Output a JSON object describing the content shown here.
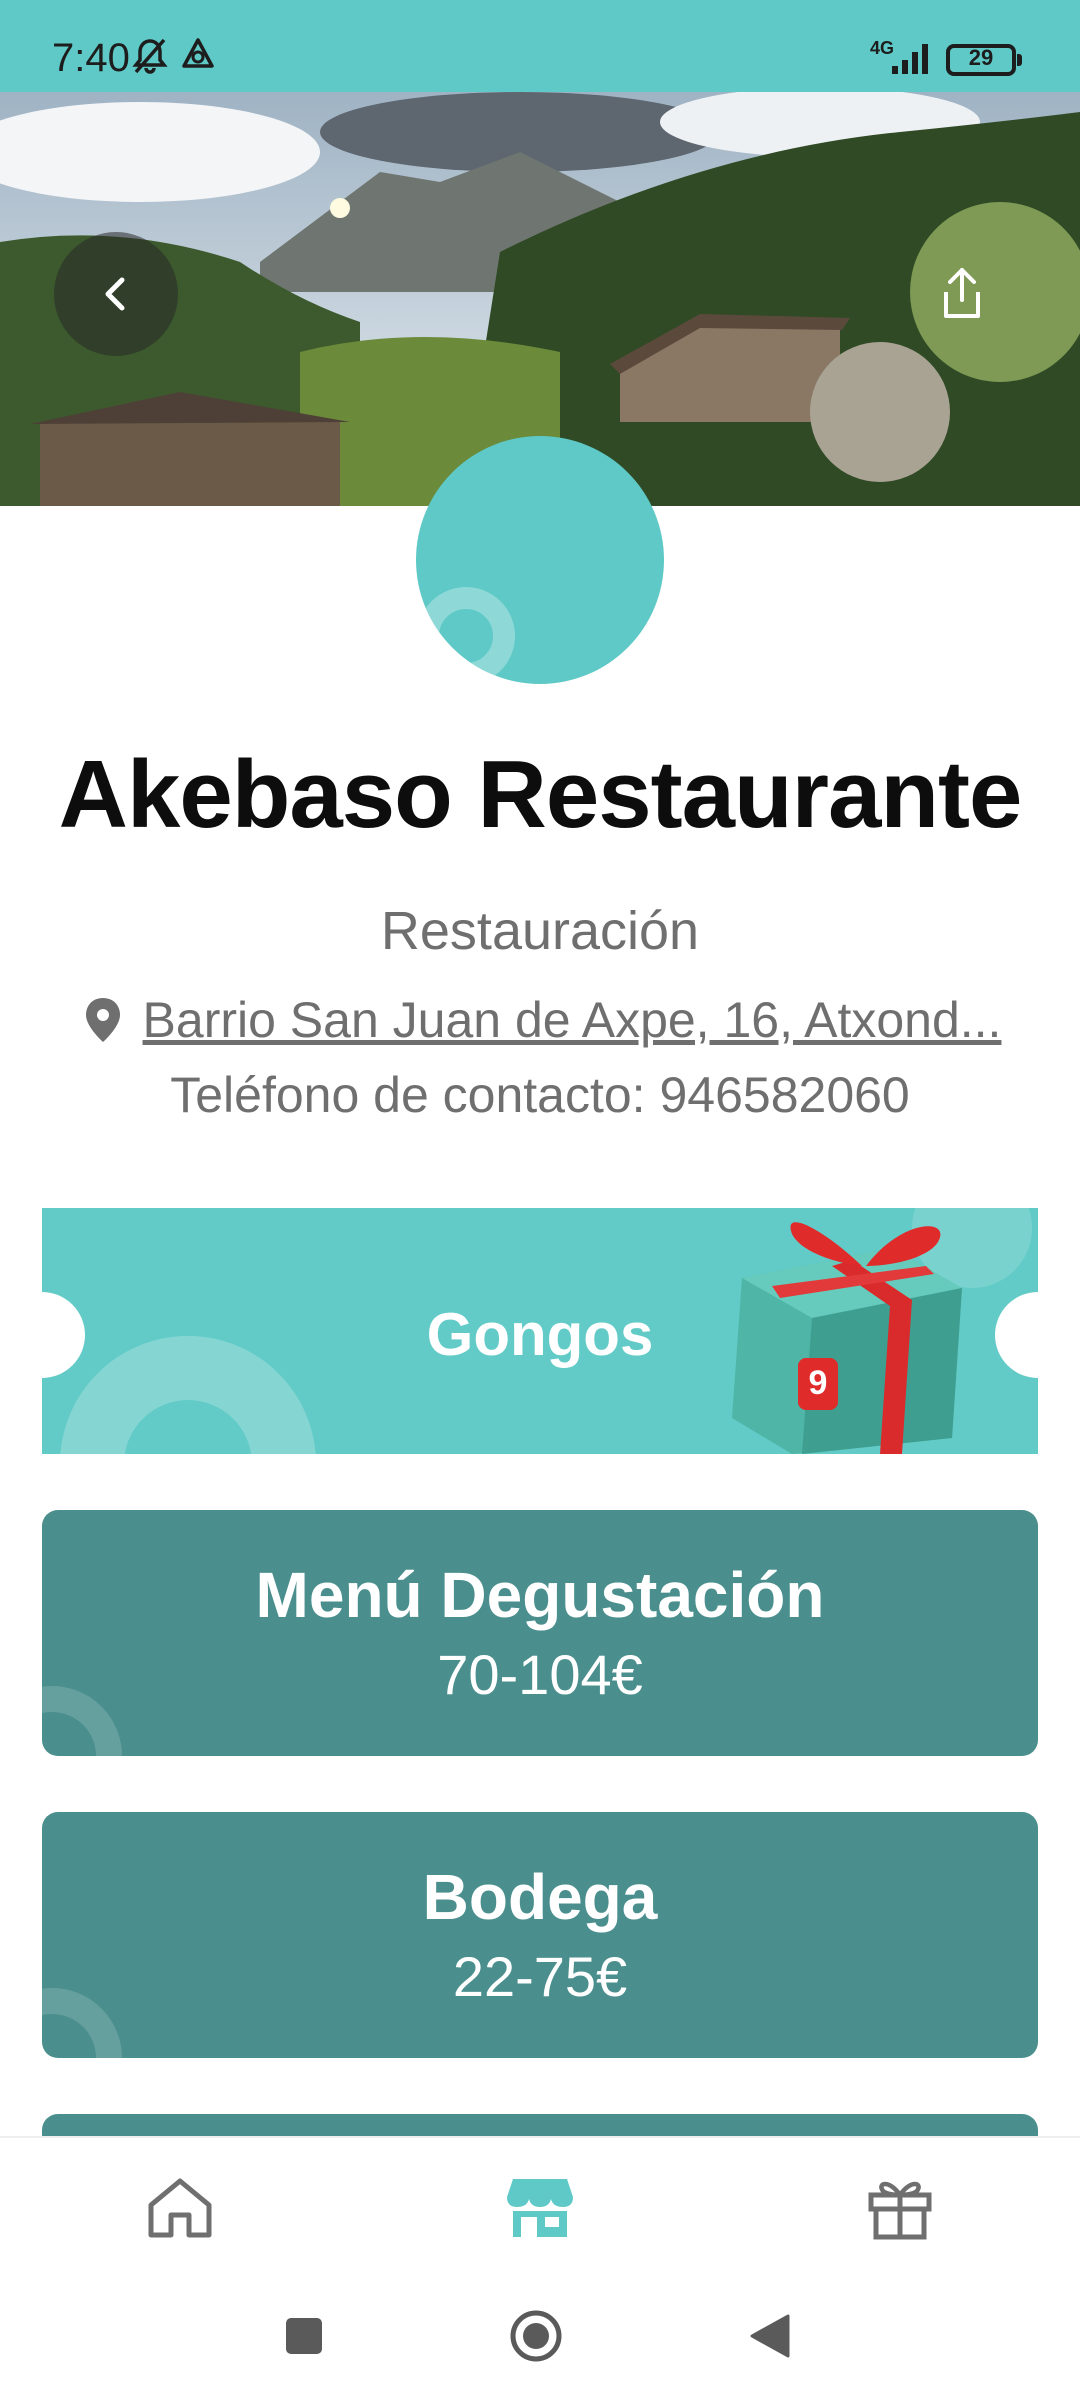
{
  "status_bar": {
    "time": "7:40",
    "network": "4G",
    "battery": "29"
  },
  "place": {
    "name": "Akebaso Restaurante",
    "category": "Restauración",
    "address": "Barrio San Juan de Axpe, 16, Atxond...",
    "phone": "Teléfono de contacto: 946582060"
  },
  "promo": {
    "label": "Gongos",
    "gift_badge": "9"
  },
  "offers": [
    {
      "title": "Menú Degustación",
      "price": "70-104€"
    },
    {
      "title": "Bodega",
      "price": "22-75€"
    }
  ],
  "icons": {
    "back": "chevron-left-icon",
    "share": "share-icon",
    "location": "location-pin-icon",
    "home": "home-icon",
    "store": "store-icon",
    "gift": "gift-icon"
  },
  "colors": {
    "accent": "#5ec9c6",
    "card": "#4a8f8d",
    "gift_ribbon": "#e02b2b"
  }
}
